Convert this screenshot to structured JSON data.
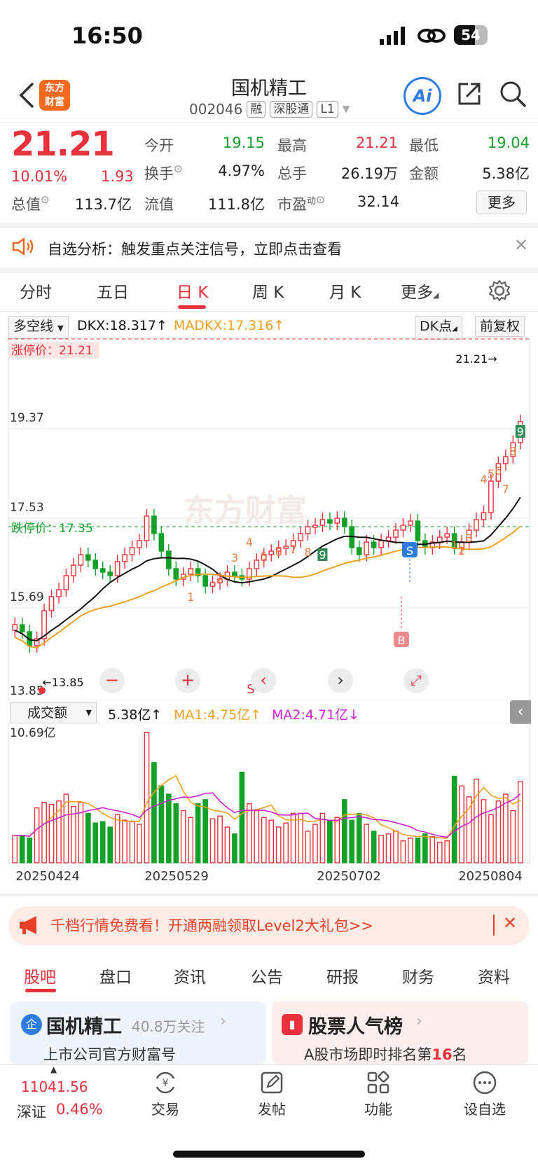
{
  "status": {
    "time": "16:50",
    "battery": "54"
  },
  "header": {
    "logo": "东方\n财富",
    "logo_line1": "东方",
    "logo_line2": "财富",
    "stock_name": "国机精工",
    "stock_code": "002046",
    "tags": [
      "融",
      "深股通",
      "L1"
    ],
    "ai_label": "Ai"
  },
  "quote": {
    "price": "21.21",
    "pct_change": "10.01%",
    "change": "1.93",
    "fields": [
      {
        "label": "今开",
        "value": "19.15",
        "color": "green"
      },
      {
        "label": "最高",
        "value": "21.21",
        "color": "red"
      },
      {
        "label": "最低",
        "value": "19.04",
        "color": "green"
      },
      {
        "label": "换手",
        "value": "4.97%",
        "color": "normal"
      },
      {
        "label": "总手",
        "value": "26.19万",
        "color": "normal"
      },
      {
        "label": "金额",
        "value": "5.38亿",
        "color": "normal"
      },
      {
        "label": "总值",
        "value": "113.7亿",
        "color": "normal"
      },
      {
        "label": "流值",
        "value": "111.8亿",
        "color": "normal"
      },
      {
        "label": "市盈",
        "value": "32.14",
        "color": "normal"
      }
    ],
    "pe_sup": "动",
    "more_label": "更多"
  },
  "notice": {
    "text": "自选分析：触发重点关注信号，立即点击查看"
  },
  "chart_tabs": [
    "分时",
    "五日",
    "日 K",
    "周 K",
    "月 K",
    "更多"
  ],
  "indicator_bar": {
    "selector": "多空线",
    "dkx": "DKX:18.317↑",
    "madkx": "MADKX:17.316↑",
    "dk_btn": "DK点",
    "adjust_btn": "前复权"
  },
  "kline": {
    "price_levels": [
      "21.21",
      "19.37",
      "17.53",
      "15.69",
      "13.85"
    ],
    "limit_up_label": "涨停价：21.21",
    "limit_down_label": "跌停价：17.35",
    "high_marker": "21.21→",
    "low_marker": "←13.85",
    "watermark": "东方财富",
    "signal_s": "S",
    "signal_b": "B",
    "seq_numbers": [
      "1",
      "2",
      "3",
      "4",
      "5",
      "6",
      "7",
      "8",
      "9",
      "1",
      "2",
      "3",
      "4",
      "5",
      "6",
      "7",
      "8",
      "9",
      "1",
      "2",
      "3",
      "4",
      "5",
      "6",
      "7",
      "8",
      "9"
    ]
  },
  "volume": {
    "selector": "成交额",
    "value": "5.38亿↑",
    "ma1": "MA1:4.75亿↑",
    "ma2": "MA2:4.71亿↓",
    "max_label": "10.69亿",
    "dates": [
      "20250424",
      "20250529",
      "20250702",
      "20250804"
    ]
  },
  "promo": {
    "text": "千档行情免费看！开通两融领取Level2大礼包>>"
  },
  "bottom_tabs": [
    "股吧",
    "盘口",
    "资讯",
    "公告",
    "研报",
    "财务",
    "资料"
  ],
  "cards": [
    {
      "title": "国机精工",
      "sub": "40.8万关注",
      "desc": "上市公司官方财富号"
    },
    {
      "title": "股票人气榜",
      "desc_pre": "A股市场即时排名第",
      "rank": "16",
      "desc_post": "名"
    }
  ],
  "bottom_nav": {
    "index_value": "11041.56",
    "index_name": "深证",
    "index_pct": "0.46%",
    "items": [
      "交易",
      "发帖",
      "功能",
      "设自选"
    ]
  },
  "colors": {
    "up": "#e8313a",
    "down": "#13a12a",
    "dkx": "#111111",
    "madkx": "#f0a020",
    "ma2": "#d020d0"
  }
}
